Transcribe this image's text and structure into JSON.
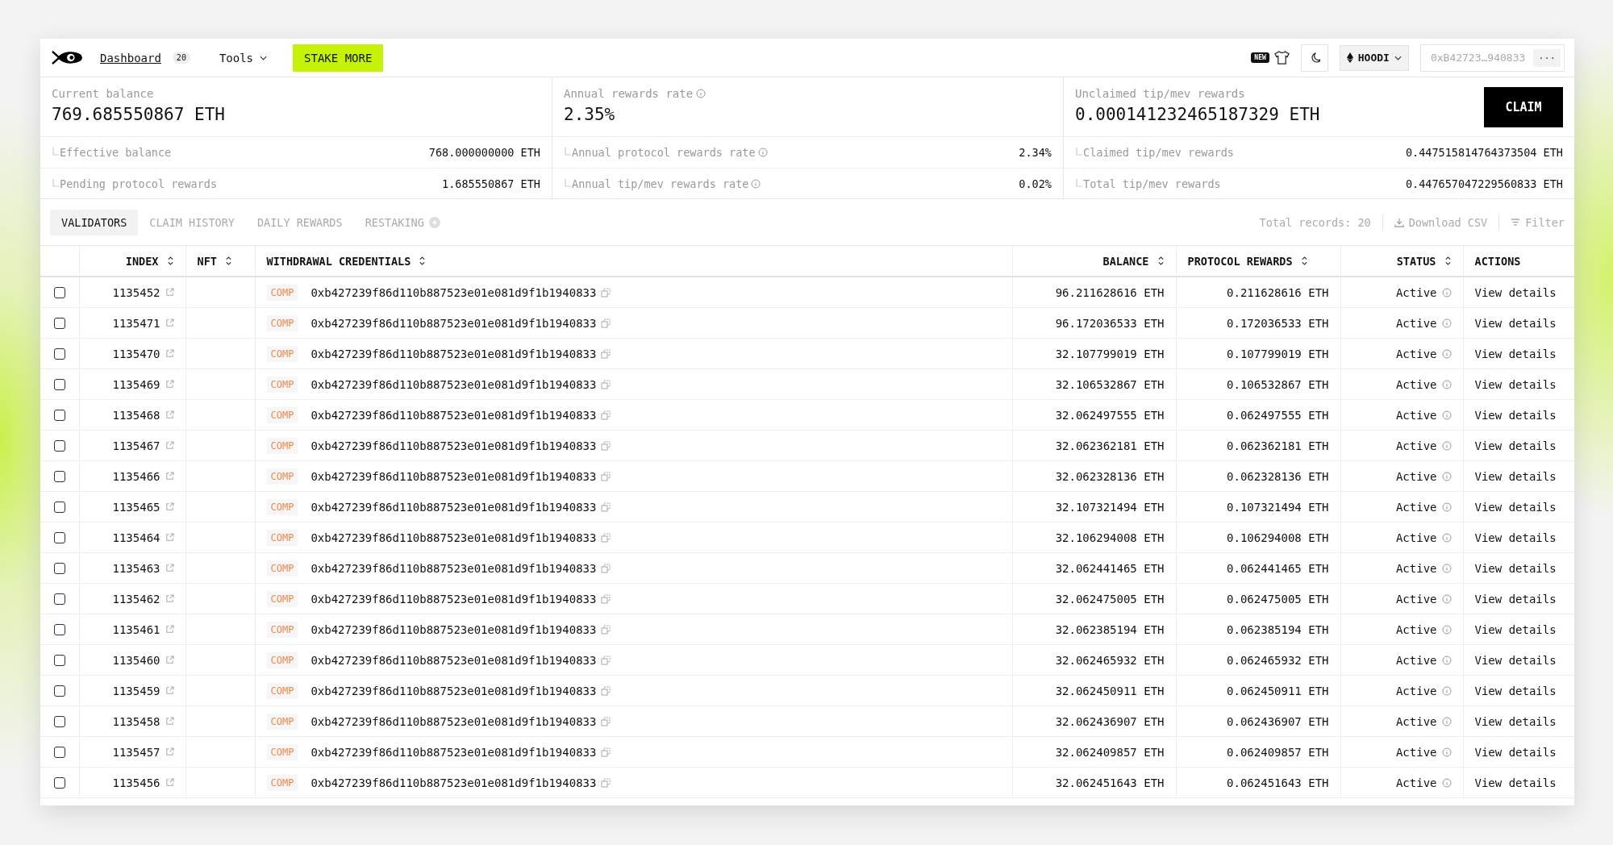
{
  "nav": {
    "dashboard": "Dashboard",
    "dashboard_count": "20",
    "tools": "Tools",
    "stake_button": "STAKE MORE",
    "new_badge": "NEW",
    "network": "HOODI",
    "wallet": "0xB42723…940833",
    "more": "···"
  },
  "summary": [
    {
      "label": "Current balance",
      "value": "769.685550867 ETH",
      "info": false,
      "details": [
        {
          "label": "Effective balance",
          "value": "768.000000000 ETH",
          "info": false
        },
        {
          "label": "Pending protocol rewards",
          "value": "1.685550867 ETH",
          "info": false
        }
      ]
    },
    {
      "label": "Annual rewards rate",
      "value": "2.35%",
      "info": true,
      "details": [
        {
          "label": "Annual protocol rewards rate",
          "value": "2.34%",
          "info": true
        },
        {
          "label": "Annual tip/mev rewards rate",
          "value": "0.02%",
          "info": true
        }
      ]
    },
    {
      "label": "Unclaimed tip/mev rewards",
      "value": "0.000141232465187329 ETH",
      "info": false,
      "button": "CLAIM",
      "details": [
        {
          "label": "Claimed tip/mev rewards",
          "value": "0.447515814764373504 ETH",
          "info": false
        },
        {
          "label": "Total tip/mev rewards",
          "value": "0.447657047229560833 ETH",
          "info": false
        }
      ]
    }
  ],
  "tabs": [
    {
      "label": "VALIDATORS",
      "selected": true
    },
    {
      "label": "CLAIM HISTORY",
      "selected": false
    },
    {
      "label": "DAILY REWARDS",
      "selected": false
    },
    {
      "label": "RESTAKING",
      "selected": false
    }
  ],
  "total_records": "Total records: 20",
  "download": "Download CSV",
  "filter": "Filter",
  "table": {
    "columns": [
      {
        "label": "INDEX",
        "sortable": true
      },
      {
        "label": "NFT",
        "sortable": true
      },
      {
        "label": "WITHDRAWAL CREDENTIALS",
        "sortable": true
      },
      {
        "label": "BALANCE",
        "sortable": true
      },
      {
        "label": "PROTOCOL REWARDS",
        "sortable": true
      },
      {
        "label": "STATUS",
        "sortable": true
      },
      {
        "label": "ACTIONS",
        "sortable": false
      }
    ],
    "rows": [
      {
        "checked": false,
        "index": "1135452",
        "type": "COMP",
        "credentials": "0xb427239f86d110b887523e01e081d9f1b1940833",
        "balance": "96.211628616 ETH",
        "rewards": "0.211628616 ETH",
        "status": "Active",
        "action": "View details"
      },
      {
        "checked": false,
        "index": "1135471",
        "type": "COMP",
        "credentials": "0xb427239f86d110b887523e01e081d9f1b1940833",
        "balance": "96.172036533 ETH",
        "rewards": "0.172036533 ETH",
        "status": "Active",
        "action": "View details"
      },
      {
        "checked": false,
        "index": "1135470",
        "type": "COMP",
        "credentials": "0xb427239f86d110b887523e01e081d9f1b1940833",
        "balance": "32.107799019 ETH",
        "rewards": "0.107799019 ETH",
        "status": "Active",
        "action": "View details"
      },
      {
        "checked": false,
        "index": "1135469",
        "type": "COMP",
        "credentials": "0xb427239f86d110b887523e01e081d9f1b1940833",
        "balance": "32.106532867 ETH",
        "rewards": "0.106532867 ETH",
        "status": "Active",
        "action": "View details"
      },
      {
        "checked": false,
        "index": "1135468",
        "type": "COMP",
        "credentials": "0xb427239f86d110b887523e01e081d9f1b1940833",
        "balance": "32.062497555 ETH",
        "rewards": "0.062497555 ETH",
        "status": "Active",
        "action": "View details"
      },
      {
        "checked": false,
        "index": "1135467",
        "type": "COMP",
        "credentials": "0xb427239f86d110b887523e01e081d9f1b1940833",
        "balance": "32.062362181 ETH",
        "rewards": "0.062362181 ETH",
        "status": "Active",
        "action": "View details"
      },
      {
        "checked": false,
        "index": "1135466",
        "type": "COMP",
        "credentials": "0xb427239f86d110b887523e01e081d9f1b1940833",
        "balance": "32.062328136 ETH",
        "rewards": "0.062328136 ETH",
        "status": "Active",
        "action": "View details"
      },
      {
        "checked": false,
        "index": "1135465",
        "type": "COMP",
        "credentials": "0xb427239f86d110b887523e01e081d9f1b1940833",
        "balance": "32.107321494 ETH",
        "rewards": "0.107321494 ETH",
        "status": "Active",
        "action": "View details"
      },
      {
        "checked": false,
        "index": "1135464",
        "type": "COMP",
        "credentials": "0xb427239f86d110b887523e01e081d9f1b1940833",
        "balance": "32.106294008 ETH",
        "rewards": "0.106294008 ETH",
        "status": "Active",
        "action": "View details"
      },
      {
        "checked": false,
        "index": "1135463",
        "type": "COMP",
        "credentials": "0xb427239f86d110b887523e01e081d9f1b1940833",
        "balance": "32.062441465 ETH",
        "rewards": "0.062441465 ETH",
        "status": "Active",
        "action": "View details"
      },
      {
        "checked": false,
        "index": "1135462",
        "type": "COMP",
        "credentials": "0xb427239f86d110b887523e01e081d9f1b1940833",
        "balance": "32.062475005 ETH",
        "rewards": "0.062475005 ETH",
        "status": "Active",
        "action": "View details"
      },
      {
        "checked": false,
        "index": "1135461",
        "type": "COMP",
        "credentials": "0xb427239f86d110b887523e01e081d9f1b1940833",
        "balance": "32.062385194 ETH",
        "rewards": "0.062385194 ETH",
        "status": "Active",
        "action": "View details"
      },
      {
        "checked": false,
        "index": "1135460",
        "type": "COMP",
        "credentials": "0xb427239f86d110b887523e01e081d9f1b1940833",
        "balance": "32.062465932 ETH",
        "rewards": "0.062465932 ETH",
        "status": "Active",
        "action": "View details"
      },
      {
        "checked": false,
        "index": "1135459",
        "type": "COMP",
        "credentials": "0xb427239f86d110b887523e01e081d9f1b1940833",
        "balance": "32.062450911 ETH",
        "rewards": "0.062450911 ETH",
        "status": "Active",
        "action": "View details"
      },
      {
        "checked": false,
        "index": "1135458",
        "type": "COMP",
        "credentials": "0xb427239f86d110b887523e01e081d9f1b1940833",
        "balance": "32.062436907 ETH",
        "rewards": "0.062436907 ETH",
        "status": "Active",
        "action": "View details"
      },
      {
        "checked": false,
        "index": "1135457",
        "type": "COMP",
        "credentials": "0xb427239f86d110b887523e01e081d9f1b1940833",
        "balance": "32.062409857 ETH",
        "rewards": "0.062409857 ETH",
        "status": "Active",
        "action": "View details"
      },
      {
        "checked": false,
        "index": "1135456",
        "type": "COMP",
        "credentials": "0xb427239f86d110b887523e01e081d9f1b1940833",
        "balance": "32.062451643 ETH",
        "rewards": "0.062451643 ETH",
        "status": "Active",
        "action": "View details"
      }
    ]
  }
}
